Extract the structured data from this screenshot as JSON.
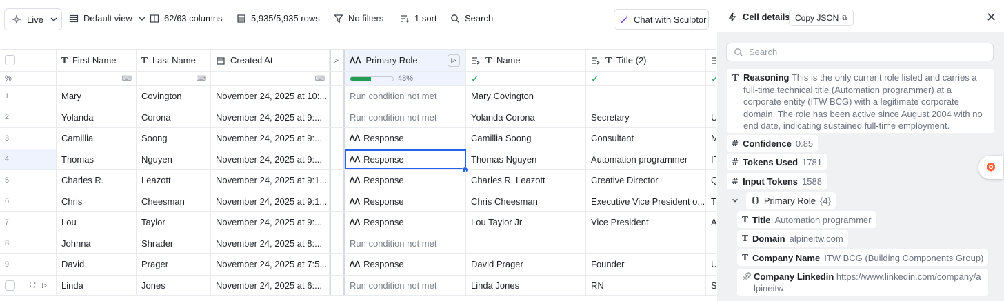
{
  "toolbar": {
    "live": "Live",
    "view": "Default view",
    "columns": "62/63 columns",
    "rows": "5,935/5,935 rows",
    "filters": "No filters",
    "sort": "1 sort",
    "search": "Search",
    "chat": "Chat with Sculptor"
  },
  "columns": {
    "first_name": "First Name",
    "last_name": "Last Name",
    "created_at": "Created At",
    "primary_role": "Primary Role",
    "name": "Name",
    "title2": "Title (2)"
  },
  "progress": {
    "label": "%",
    "value": 0.48,
    "text": "48%"
  },
  "rows": [
    {
      "n": "1",
      "first": "Mary",
      "last": "Covington",
      "created": "November 24, 2025 at 10:...",
      "role": "Run condition not met",
      "role_type": "muted",
      "name": "Mary Covington",
      "title": "",
      "extra": ""
    },
    {
      "n": "2",
      "first": "Yolanda",
      "last": "Corona",
      "created": "November 24, 2025 at 9:...",
      "role": "Run condition not met",
      "role_type": "muted",
      "name": "Yolanda Corona",
      "title": "Secretary",
      "extra": "U"
    },
    {
      "n": "3",
      "first": "Camillia",
      "last": "Soong",
      "created": "November 24, 2025 at 9:...",
      "role": "Response",
      "role_type": "response",
      "name": "Camillia Soong",
      "title": "Consultant",
      "extra": "M"
    },
    {
      "n": "4",
      "first": "Thomas",
      "last": "Nguyen",
      "created": "November 24, 2025 at 9:...",
      "role": "Response",
      "role_type": "response",
      "name": "Thomas Nguyen",
      "title": "Automation programmer",
      "extra": "IT"
    },
    {
      "n": "5",
      "first": "Charles R.",
      "last": "Leazott",
      "created": "November 24, 2025 at 9:1...",
      "role": "Response",
      "role_type": "response",
      "name": "Charles R. Leazott",
      "title": "Creative Director",
      "extra": "Q"
    },
    {
      "n": "6",
      "first": "Chris",
      "last": "Cheesman",
      "created": "November 24, 2025 at 9:1...",
      "role": "Response",
      "role_type": "response",
      "name": "Chris Cheesman",
      "title": "Executive Vice President o...",
      "extra": "Tr"
    },
    {
      "n": "7",
      "first": "Lou",
      "last": "Taylor",
      "created": "November 24, 2025 at 9:...",
      "role": "Response",
      "role_type": "response",
      "name": "Lou Taylor Jr",
      "title": "Vice President",
      "extra": "A"
    },
    {
      "n": "8",
      "first": "Johnna",
      "last": "Shrader",
      "created": "November 24, 2025 at 8:...",
      "role": "Run condition not met",
      "role_type": "muted",
      "name": "",
      "title": "",
      "extra": ""
    },
    {
      "n": "9",
      "first": "David",
      "last": "Prager",
      "created": "November 24, 2025 at 7:5...",
      "role": "Response",
      "role_type": "response",
      "name": "David Prager",
      "title": "Founder",
      "extra": "U"
    },
    {
      "n": "",
      "first": "Linda",
      "last": "Jones",
      "created": "November 24, 2025 at 6:...",
      "role": "Run condition not met",
      "role_type": "muted",
      "name": "Linda Jones",
      "title": "RN",
      "extra": "S"
    }
  ],
  "panel": {
    "title": "Cell details",
    "copy": "Copy JSON",
    "search_placeholder": "Search",
    "reasoning_key": "Reasoning",
    "reasoning_value": "This is the only current role listed and carries a full-time technical title (Automation programmer) at a corporate entity (ITW BCG) with a legitimate corporate domain. The role has been active since August 2004 with no end date, indicating sustained full-time employment.",
    "confidence_key": "Confidence",
    "confidence_value": "0.85",
    "tokens_key": "Tokens Used",
    "tokens_value": "1781",
    "input_key": "Input Tokens",
    "input_value": "1588",
    "role_key": "Primary Role",
    "role_count": "{4}",
    "title_key": "Title",
    "title_value": "Automation programmer",
    "domain_key": "Domain",
    "domain_value": "alpineitw.com",
    "company_key": "Company Name",
    "company_value": "ITW BCG (Building Components Group)",
    "linkedin_key": "Company Linkedin",
    "linkedin_value": "https://www.linkedin.com/company/alpineitw"
  }
}
